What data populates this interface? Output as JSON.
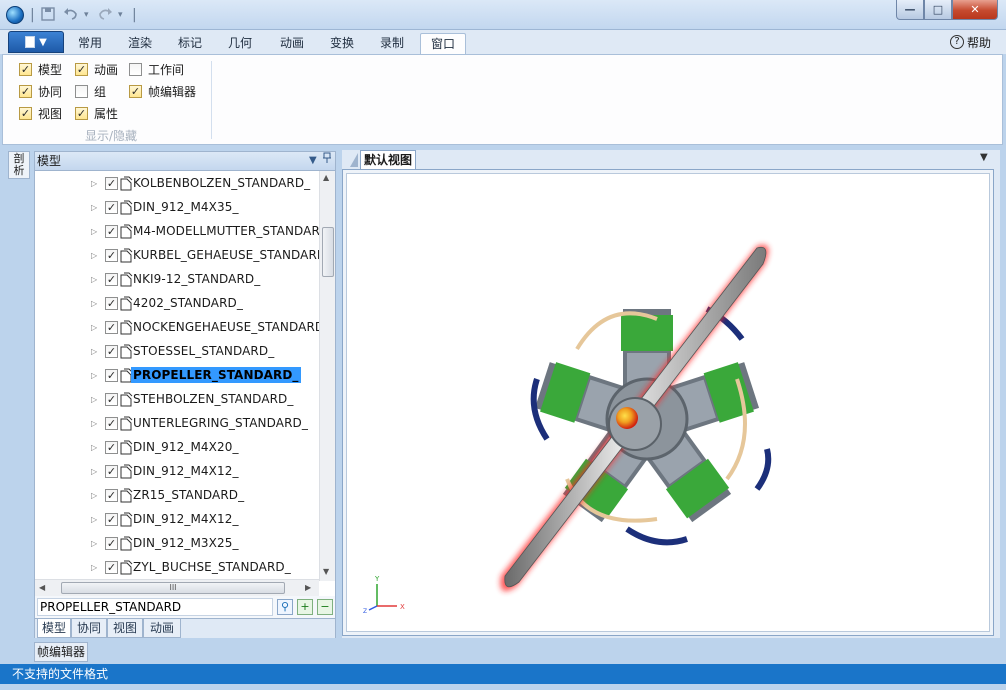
{
  "window": {
    "minimize": "—",
    "maximize": "□",
    "close": "✕"
  },
  "quick_access": {
    "save_icon": "save-icon",
    "undo_icon": "undo-icon",
    "redo_icon": "redo-icon"
  },
  "ribbon": {
    "file_button_arrow": "▼",
    "tabs": [
      {
        "label": "常用",
        "active": false
      },
      {
        "label": "渲染",
        "active": false
      },
      {
        "label": "标记",
        "active": false
      },
      {
        "label": "几何",
        "active": false
      },
      {
        "label": "动画",
        "active": false
      },
      {
        "label": "变换",
        "active": false
      },
      {
        "label": "录制",
        "active": false
      },
      {
        "label": "窗口",
        "active": true
      }
    ],
    "help_label": "帮助",
    "group_label": "显示/隐藏",
    "checkboxes": [
      {
        "label": "模型",
        "checked": true
      },
      {
        "label": "动画",
        "checked": true
      },
      {
        "label": "工作间",
        "checked": false
      },
      {
        "label": "协同",
        "checked": true
      },
      {
        "label": "组",
        "checked": false
      },
      {
        "label": "帧编辑器",
        "checked": true
      },
      {
        "label": "视图",
        "checked": true
      },
      {
        "label": "属性",
        "checked": true
      }
    ]
  },
  "side_strip": {
    "label": "剖析"
  },
  "model_panel": {
    "title": "模型",
    "pin": "▼ 📌",
    "tree_items": [
      {
        "label": "KOLBENBOLZEN_STANDARD_",
        "checked": true,
        "selected": false
      },
      {
        "label": "DIN_912_M4X35_",
        "checked": true,
        "selected": false
      },
      {
        "label": "M4-MODELLMUTTER_STANDAR",
        "checked": true,
        "selected": false
      },
      {
        "label": "KURBEL_GEHAEUSE_STANDARD",
        "checked": true,
        "selected": false
      },
      {
        "label": "NKI9-12_STANDARD_",
        "checked": true,
        "selected": false
      },
      {
        "label": "4202_STANDARD_",
        "checked": true,
        "selected": false
      },
      {
        "label": "NOCKENGEHAEUSE_STANDARD",
        "checked": true,
        "selected": false
      },
      {
        "label": "STOESSEL_STANDARD_",
        "checked": true,
        "selected": false
      },
      {
        "label": "PROPELLER_STANDARD_",
        "checked": true,
        "selected": true
      },
      {
        "label": "STEHBOLZEN_STANDARD_",
        "checked": true,
        "selected": false
      },
      {
        "label": "UNTERLEGRING_STANDARD_",
        "checked": true,
        "selected": false
      },
      {
        "label": "DIN_912_M4X20_",
        "checked": true,
        "selected": false
      },
      {
        "label": "DIN_912_M4X12_",
        "checked": true,
        "selected": false
      },
      {
        "label": "ZR15_STANDARD_",
        "checked": true,
        "selected": false
      },
      {
        "label": "DIN_912_M4X12_",
        "checked": true,
        "selected": false
      },
      {
        "label": "DIN_912_M3X25_",
        "checked": true,
        "selected": false
      },
      {
        "label": "ZYL_BUCHSE_STANDARD_",
        "checked": true,
        "selected": false
      }
    ],
    "search_value": "PROPELLER_STANDARD",
    "hscroll_grip": "III",
    "bottom_tabs": [
      {
        "label": "模型",
        "active": true
      },
      {
        "label": "协同",
        "active": false
      },
      {
        "label": "视图",
        "active": false
      },
      {
        "label": "动画",
        "active": false
      }
    ]
  },
  "frame_editor_tab": "帧编辑器",
  "view": {
    "tab_label": "默认视图",
    "axis_x": "X",
    "axis_y": "Y",
    "axis_z": "Z"
  },
  "status": {
    "text": "不支持的文件格式"
  }
}
